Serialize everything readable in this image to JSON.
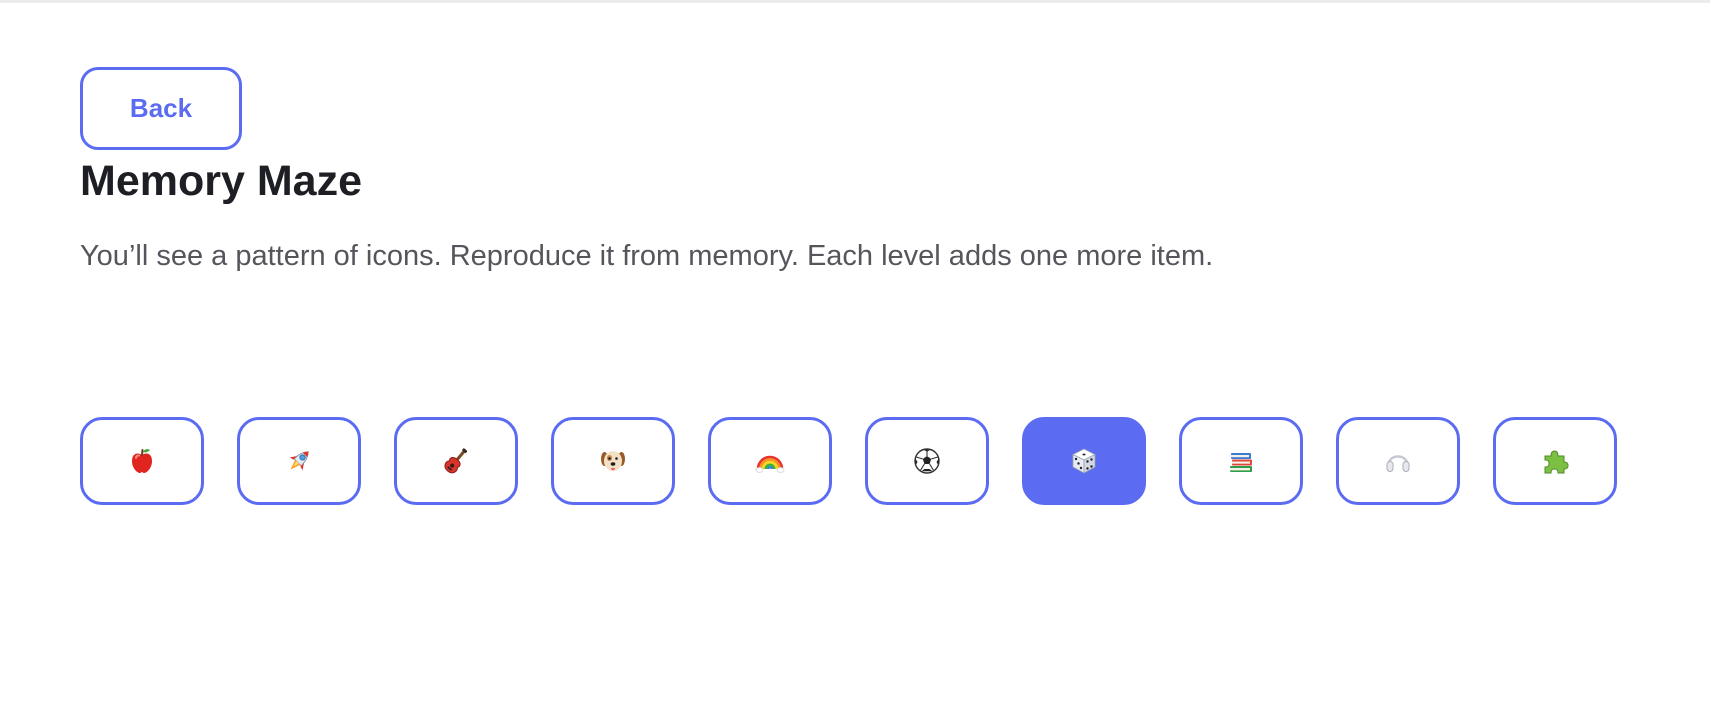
{
  "header": {
    "back_label": "Back",
    "title": "Memory Maze",
    "instructions": "You’ll see a pattern of icons. Reproduce it from memory. Each level adds one more item."
  },
  "colors": {
    "accent": "#5b6cf2",
    "title": "#1d1f24",
    "body_text": "#55565c",
    "background": "#ffffff"
  },
  "tiles": [
    {
      "icon": "apple-icon",
      "selected": false
    },
    {
      "icon": "rocket-icon",
      "selected": false
    },
    {
      "icon": "guitar-icon",
      "selected": false
    },
    {
      "icon": "dog-icon",
      "selected": false
    },
    {
      "icon": "rainbow-icon",
      "selected": false
    },
    {
      "icon": "soccer-ball-icon",
      "selected": false
    },
    {
      "icon": "dice-icon",
      "selected": true
    },
    {
      "icon": "books-icon",
      "selected": false
    },
    {
      "icon": "headphones-icon",
      "selected": false
    },
    {
      "icon": "puzzle-piece-icon",
      "selected": false
    }
  ]
}
